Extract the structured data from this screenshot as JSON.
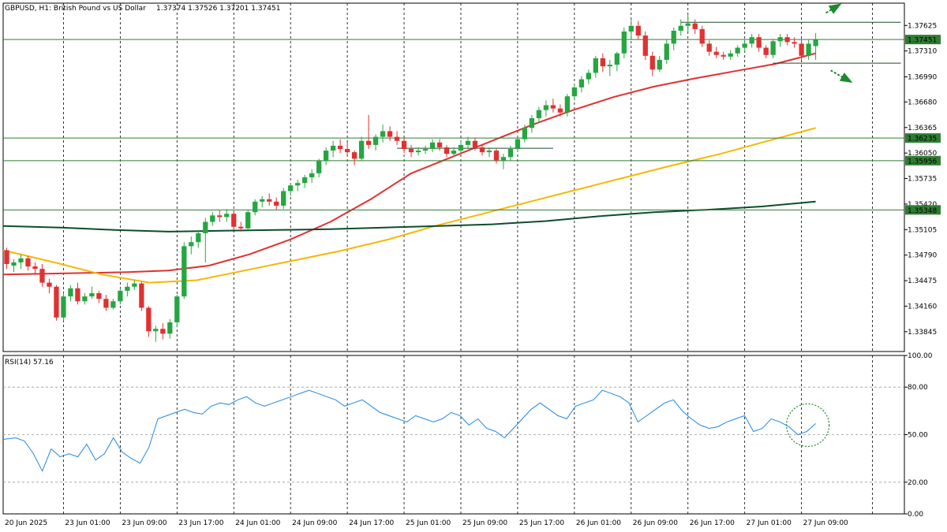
{
  "header": {
    "symbol_line": "GBPUSD, H1:  British Pound vs US Dollar",
    "ohlc": "1.37374  1.37526  1.37201  1.37451"
  },
  "rsi_panel": {
    "label": "RSI(14) 57.16"
  },
  "colors": {
    "bull": "#26a641",
    "bear": "#e03131",
    "ma_fast": "#e03131",
    "ma_mid": "#f5b800",
    "ma_slow": "#0d4d2c",
    "rsi": "#1e88e5",
    "level_line": "#2e7d32",
    "tag_bg": "#2e7d32",
    "arrow": "#1b8a2e"
  },
  "chart_data": [
    {
      "type": "candlestick",
      "title": "GBPUSD, H1: British Pound vs US Dollar",
      "ylim": [
        1.336,
        1.379
      ],
      "y_ticks": [
        "1.37625",
        "1.37310",
        "1.36990",
        "1.36680",
        "1.36365",
        "1.36050",
        "1.35735",
        "1.35420",
        "1.35105",
        "1.34790",
        "1.34475",
        "1.34160",
        "1.33845"
      ],
      "x_labels": [
        "20 Jun 2025",
        "23 Jun 01:00",
        "23 Jun 09:00",
        "23 Jun 17:00",
        "24 Jun 01:00",
        "24 Jun 09:00",
        "24 Jun 17:00",
        "25 Jun 01:00",
        "25 Jun 09:00",
        "25 Jun 17:00",
        "26 Jun 01:00",
        "26 Jun 09:00",
        "26 Jun 17:00",
        "27 Jun 01:00",
        "27 Jun 09:00"
      ],
      "price_levels": [
        {
          "value": 1.37451,
          "label": "1.37451"
        },
        {
          "value": 1.36235,
          "label": "1.36235"
        },
        {
          "value": 1.35956,
          "label": "1.35956"
        },
        {
          "value": 1.35348,
          "label": "1.35348"
        }
      ],
      "candles": [
        [
          1.3485,
          1.3488,
          1.3462,
          1.3468
        ],
        [
          1.3466,
          1.3474,
          1.3458,
          1.347
        ],
        [
          1.347,
          1.348,
          1.3462,
          1.3475
        ],
        [
          1.3475,
          1.3478,
          1.346,
          1.3465
        ],
        [
          1.3465,
          1.347,
          1.3455,
          1.3462
        ],
        [
          1.3462,
          1.3468,
          1.344,
          1.3445
        ],
        [
          1.3445,
          1.345,
          1.3432,
          1.344
        ],
        [
          1.344,
          1.3442,
          1.3398,
          1.3402
        ],
        [
          1.3402,
          1.3432,
          1.3398,
          1.3428
        ],
        [
          1.3428,
          1.3442,
          1.3422,
          1.3438
        ],
        [
          1.3438,
          1.3445,
          1.3418,
          1.3422
        ],
        [
          1.3422,
          1.3432,
          1.3418,
          1.3428
        ],
        [
          1.3428,
          1.344,
          1.3425,
          1.3432
        ],
        [
          1.3432,
          1.3435,
          1.342,
          1.3425
        ],
        [
          1.3425,
          1.343,
          1.341,
          1.3414
        ],
        [
          1.3414,
          1.3425,
          1.3412,
          1.3422
        ],
        [
          1.3422,
          1.3438,
          1.3418,
          1.3435
        ],
        [
          1.3435,
          1.3445,
          1.3428,
          1.344
        ],
        [
          1.344,
          1.3448,
          1.3436,
          1.3444
        ],
        [
          1.3444,
          1.3446,
          1.341,
          1.3414
        ],
        [
          1.3414,
          1.3416,
          1.3378,
          1.3385
        ],
        [
          1.3385,
          1.3392,
          1.3372,
          1.3388
        ],
        [
          1.3388,
          1.3395,
          1.3375,
          1.3382
        ],
        [
          1.3382,
          1.34,
          1.3376,
          1.3396
        ],
        [
          1.3396,
          1.343,
          1.339,
          1.3428
        ],
        [
          1.3428,
          1.3495,
          1.3425,
          1.349
        ],
        [
          1.349,
          1.3502,
          1.348,
          1.3495
        ],
        [
          1.3495,
          1.351,
          1.3488,
          1.3506
        ],
        [
          1.3506,
          1.3525,
          1.347,
          1.352
        ],
        [
          1.352,
          1.3532,
          1.3515,
          1.3528
        ],
        [
          1.3528,
          1.3534,
          1.352,
          1.3526
        ],
        [
          1.3526,
          1.3536,
          1.352,
          1.353
        ],
        [
          1.353,
          1.3534,
          1.351,
          1.3514
        ],
        [
          1.3514,
          1.352,
          1.3508,
          1.3512
        ],
        [
          1.3512,
          1.3535,
          1.351,
          1.3532
        ],
        [
          1.3532,
          1.3548,
          1.3528,
          1.3545
        ],
        [
          1.3545,
          1.3552,
          1.3538,
          1.3548
        ],
        [
          1.3548,
          1.3555,
          1.354,
          1.3545
        ],
        [
          1.3545,
          1.355,
          1.3535,
          1.354
        ],
        [
          1.354,
          1.3562,
          1.3536,
          1.3558
        ],
        [
          1.3558,
          1.3568,
          1.3552,
          1.3565
        ],
        [
          1.3565,
          1.3572,
          1.3558,
          1.3568
        ],
        [
          1.3568,
          1.3578,
          1.3562,
          1.3575
        ],
        [
          1.3575,
          1.3585,
          1.3568,
          1.358
        ],
        [
          1.358,
          1.3598,
          1.3575,
          1.3595
        ],
        [
          1.3595,
          1.3612,
          1.359,
          1.3608
        ],
        [
          1.3608,
          1.362,
          1.36,
          1.3614
        ],
        [
          1.3614,
          1.3622,
          1.3605,
          1.361
        ],
        [
          1.361,
          1.3618,
          1.3602,
          1.3606
        ],
        [
          1.3606,
          1.3608,
          1.359,
          1.3598
        ],
        [
          1.3598,
          1.3625,
          1.3595,
          1.362
        ],
        [
          1.362,
          1.3652,
          1.361,
          1.3615
        ],
        [
          1.3615,
          1.3628,
          1.3608,
          1.3625
        ],
        [
          1.3625,
          1.364,
          1.3618,
          1.3632
        ],
        [
          1.3632,
          1.3638,
          1.362,
          1.3625
        ],
        [
          1.3625,
          1.3632,
          1.3615,
          1.362
        ],
        [
          1.362,
          1.3624,
          1.3605,
          1.361
        ],
        [
          1.361,
          1.3615,
          1.36,
          1.3606
        ],
        [
          1.3606,
          1.3612,
          1.3602,
          1.3608
        ],
        [
          1.3608,
          1.3614,
          1.3604,
          1.361
        ],
        [
          1.361,
          1.3622,
          1.3606,
          1.3618
        ],
        [
          1.3618,
          1.3622,
          1.3608,
          1.3612
        ],
        [
          1.3612,
          1.3615,
          1.36,
          1.3604
        ],
        [
          1.3604,
          1.3612,
          1.36,
          1.3608
        ],
        [
          1.3608,
          1.362,
          1.3604,
          1.3615
        ],
        [
          1.3615,
          1.3625,
          1.361,
          1.362
        ],
        [
          1.362,
          1.3624,
          1.3608,
          1.3612
        ],
        [
          1.3612,
          1.3616,
          1.3602,
          1.3606
        ],
        [
          1.3606,
          1.3612,
          1.36,
          1.3608
        ],
        [
          1.3608,
          1.361,
          1.3592,
          1.3596
        ],
        [
          1.3596,
          1.3604,
          1.3585,
          1.36
        ],
        [
          1.36,
          1.3614,
          1.3596,
          1.361
        ],
        [
          1.361,
          1.3625,
          1.3606,
          1.3622
        ],
        [
          1.3622,
          1.364,
          1.3618,
          1.3636
        ],
        [
          1.3636,
          1.3652,
          1.363,
          1.3648
        ],
        [
          1.3648,
          1.3662,
          1.3642,
          1.3658
        ],
        [
          1.3658,
          1.367,
          1.365,
          1.3664
        ],
        [
          1.3664,
          1.3672,
          1.3655,
          1.366
        ],
        [
          1.366,
          1.3665,
          1.365,
          1.3655
        ],
        [
          1.3655,
          1.3678,
          1.365,
          1.3675
        ],
        [
          1.3675,
          1.369,
          1.367,
          1.3686
        ],
        [
          1.3686,
          1.37,
          1.368,
          1.3696
        ],
        [
          1.3696,
          1.3708,
          1.369,
          1.3704
        ],
        [
          1.3704,
          1.3725,
          1.3698,
          1.3722
        ],
        [
          1.3722,
          1.3728,
          1.3705,
          1.3712
        ],
        [
          1.3712,
          1.372,
          1.37,
          1.3714
        ],
        [
          1.3714,
          1.373,
          1.3706,
          1.3728
        ],
        [
          1.3728,
          1.376,
          1.3722,
          1.3755
        ],
        [
          1.3755,
          1.377,
          1.3745,
          1.3762
        ],
        [
          1.3762,
          1.3768,
          1.3745,
          1.375
        ],
        [
          1.375,
          1.3755,
          1.372,
          1.3725
        ],
        [
          1.3725,
          1.373,
          1.37,
          1.3708
        ],
        [
          1.3708,
          1.3725,
          1.3705,
          1.372
        ],
        [
          1.372,
          1.3745,
          1.3715,
          1.374
        ],
        [
          1.374,
          1.376,
          1.3732,
          1.3756
        ],
        [
          1.3756,
          1.377,
          1.375,
          1.3762
        ],
        [
          1.3762,
          1.3776,
          1.3755,
          1.3765
        ],
        [
          1.3765,
          1.377,
          1.3752,
          1.3758
        ],
        [
          1.3758,
          1.3762,
          1.3736,
          1.374
        ],
        [
          1.374,
          1.3744,
          1.3725,
          1.373
        ],
        [
          1.373,
          1.3736,
          1.3722,
          1.3726
        ],
        [
          1.3726,
          1.373,
          1.372,
          1.3724
        ],
        [
          1.3724,
          1.3732,
          1.372,
          1.3728
        ],
        [
          1.3728,
          1.3738,
          1.3724,
          1.3735
        ],
        [
          1.3735,
          1.3745,
          1.373,
          1.374
        ],
        [
          1.374,
          1.3752,
          1.3735,
          1.3748
        ],
        [
          1.3748,
          1.3752,
          1.373,
          1.3735
        ],
        [
          1.3735,
          1.3738,
          1.3722,
          1.3726
        ],
        [
          1.3726,
          1.3746,
          1.3722,
          1.3743
        ],
        [
          1.3743,
          1.3752,
          1.3736,
          1.3748
        ],
        [
          1.3748,
          1.3752,
          1.3738,
          1.3742
        ],
        [
          1.3742,
          1.3748,
          1.3735,
          1.374
        ],
        [
          1.374,
          1.3746,
          1.372,
          1.3725
        ],
        [
          1.3725,
          1.3745,
          1.372,
          1.374
        ],
        [
          1.3737,
          1.3753,
          1.372,
          1.3745
        ]
      ],
      "series": [
        {
          "key": "ma_fast",
          "values": [
            1.3455,
            1.3456,
            1.3457,
            1.3458,
            1.346,
            1.3466,
            1.348,
            1.3498,
            1.352,
            1.3548,
            1.358,
            1.36,
            1.362,
            1.364,
            1.3658,
            1.3674,
            1.3687,
            1.3697,
            1.3706,
            1.3715,
            1.3728
          ]
        },
        {
          "key": "ma_mid",
          "values": [
            1.3485,
            1.347,
            1.3455,
            1.3445,
            1.3448,
            1.346,
            1.3472,
            1.3484,
            1.3498,
            1.3515,
            1.353,
            1.3545,
            1.356,
            1.3575,
            1.359,
            1.3604,
            1.362,
            1.3636
          ]
        },
        {
          "key": "ma_slow",
          "values": [
            1.3515,
            1.3513,
            1.351,
            1.3508,
            1.3509,
            1.351,
            1.3511,
            1.3513,
            1.3515,
            1.3517,
            1.3521,
            1.3527,
            1.3532,
            1.3535,
            1.3539,
            1.3545
          ]
        }
      ],
      "annotations": [
        {
          "type": "segment",
          "x": [
            95,
            126
          ],
          "y": 1.37664
        },
        {
          "type": "segment",
          "x": [
            55,
            77
          ],
          "y": 1.36109
        },
        {
          "type": "segment",
          "x": [
            108,
            126
          ],
          "y": 1.37159
        },
        {
          "type": "arrow",
          "direction": "up"
        },
        {
          "type": "arrow",
          "direction": "down"
        }
      ]
    },
    {
      "type": "line",
      "title": "RSI(14) 57.16",
      "ylim": [
        0,
        100
      ],
      "y_ticks": [
        "100.00",
        "80.00",
        "50.00",
        "20.00",
        "0.00"
      ],
      "values": [
        47,
        48,
        46,
        38,
        27,
        41,
        36,
        38,
        36,
        44,
        34,
        38,
        48,
        39,
        35,
        32,
        42,
        60,
        62,
        64,
        66,
        64,
        63,
        68,
        70,
        69,
        72,
        74,
        70,
        68,
        70,
        72,
        74,
        76,
        78,
        76,
        74,
        72,
        68,
        70,
        72,
        68,
        64,
        62,
        60,
        58,
        62,
        60,
        58,
        60,
        64,
        62,
        56,
        60,
        54,
        52,
        48,
        54,
        60,
        66,
        70,
        66,
        62,
        60,
        68,
        70,
        72,
        78,
        76,
        74,
        70,
        58,
        62,
        66,
        70,
        72,
        65,
        60,
        56,
        54,
        55,
        58,
        60,
        62,
        52,
        54,
        60,
        58,
        55,
        50,
        52,
        57
      ]
    }
  ]
}
